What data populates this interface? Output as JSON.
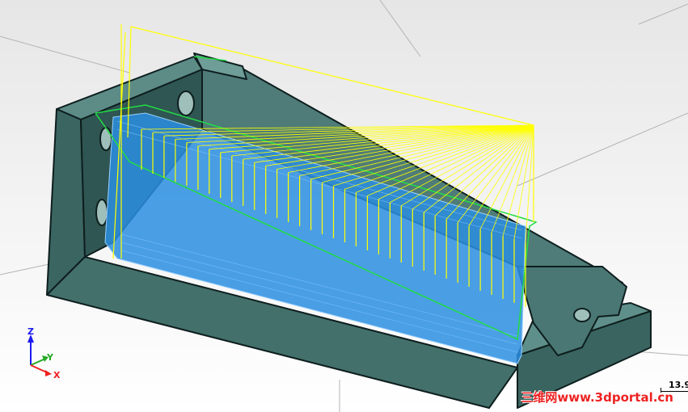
{
  "viewport": {
    "background_top": "#e6e6e6",
    "background_bottom": "#ffffff",
    "part_color": "#3f6a66",
    "part_edge_color": "#0e1e1e",
    "pocket_color": "#2a8ee0",
    "toolpath_color": "#ffff00",
    "boundary_color": "#22dd44"
  },
  "triad": {
    "z_label": "Z",
    "y_label": "Y",
    "x_label": "X",
    "z_color": "#1a1aee",
    "y_color": "#22aa22",
    "x_color": "#ee2222"
  },
  "scale": {
    "value": "13.9"
  },
  "watermark": {
    "text": "三维网www.3dportal.cn"
  }
}
